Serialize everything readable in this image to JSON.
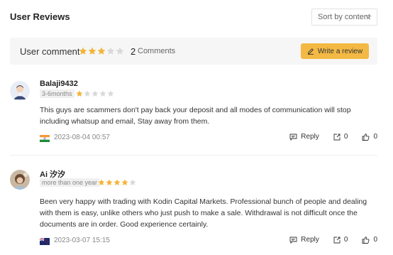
{
  "header": {
    "title": "User Reviews",
    "sort_label": "Sort by content"
  },
  "summary": {
    "label": "User comment",
    "rating": 3,
    "max_rating": 5,
    "count": "2",
    "count_label": "Comments",
    "write_label": "Write a review"
  },
  "colors": {
    "star_filled": "#f4b43a",
    "star_empty": "#d9d9d9",
    "write_button": "#f3b944",
    "summary_bg": "#f6f6f6"
  },
  "reviews": [
    {
      "username": "Balaji9432",
      "duration": "3-6months",
      "rating": 1,
      "text": "This guys are scammers don't pay back your deposit and all modes of communication will stop including whatsup and email, Stay away from them.",
      "flag": "india",
      "date": "2023-08-04 00:57",
      "reply_label": "Reply",
      "share_count": "0",
      "like_count": "0"
    },
    {
      "username": "Ai 汐汐",
      "duration": "more than one year",
      "rating": 4,
      "text": "Been very happy with trading with Kodin Capital Markets. Professional bunch of people and dealing with them is easy, unlike others who just push to make a sale. Withdrawal is not difficult once the documents are in order. Good experience certainly.",
      "flag": "new-zealand",
      "date": "2023-03-07 15:15",
      "reply_label": "Reply",
      "share_count": "0",
      "like_count": "0"
    }
  ]
}
